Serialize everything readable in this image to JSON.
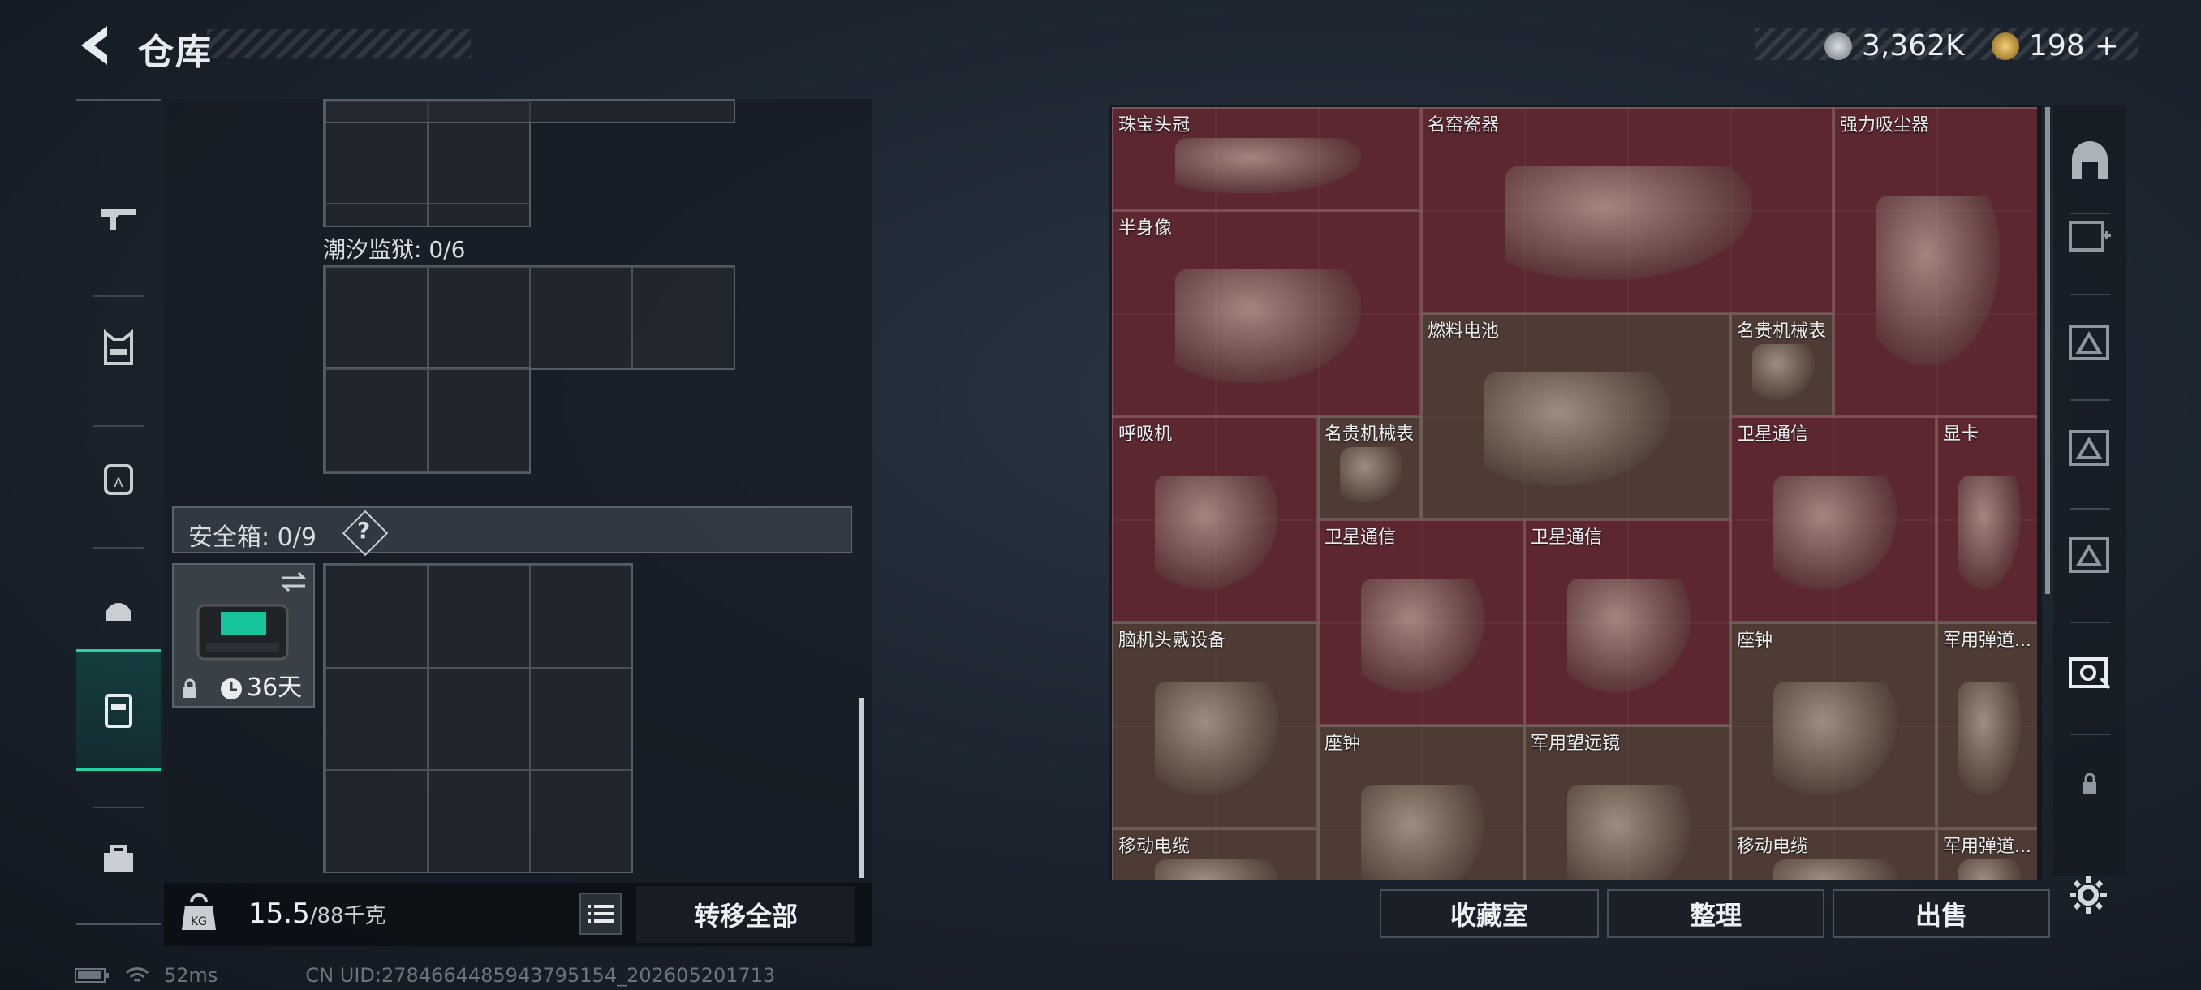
{
  "header": {
    "title": "仓库",
    "back_icon": "back-arrow-icon"
  },
  "currency": [
    {
      "icon": "silver-coin-icon",
      "color": "#a9b2ba",
      "value": "3,362K"
    },
    {
      "icon": "gold-coin-icon",
      "color": "#c9a447",
      "value": "198"
    }
  ],
  "currency_plus": "+",
  "rail": {
    "items": [
      {
        "name": "gun-icon"
      },
      {
        "name": "vest-icon"
      },
      {
        "name": "backpack-icon"
      },
      {
        "name": "helmet-icon"
      },
      {
        "name": "safe-box-icon"
      },
      {
        "name": "toolbox-icon"
      }
    ],
    "active_index": 4
  },
  "left": {
    "tide_prison_label": "潮汐监狱: 0/6",
    "safe_box_label": "安全箱: 0/9",
    "help_label": "?",
    "safe_item": {
      "duration": "36天"
    },
    "weight": {
      "current": "15.5",
      "max": "/88千克"
    },
    "transfer_all": "转移全部"
  },
  "right": {
    "items": [
      {
        "name": "珠宝头冠",
        "col": 0,
        "row": 0,
        "w": 3,
        "h": 1,
        "bg": "maroon"
      },
      {
        "name": "名窑瓷器",
        "col": 3,
        "row": 0,
        "w": 4,
        "h": 2,
        "bg": "maroon"
      },
      {
        "name": "强力吸尘器",
        "col": 7,
        "row": 0,
        "w": 2,
        "h": 3,
        "bg": "maroon"
      },
      {
        "name": "半身像",
        "col": 0,
        "row": 1,
        "w": 3,
        "h": 2,
        "bg": "maroon"
      },
      {
        "name": "燃料电池",
        "col": 3,
        "row": 2,
        "w": 3,
        "h": 2,
        "bg": "brown"
      },
      {
        "name": "名贵机械表",
        "col": 6,
        "row": 2,
        "w": 1,
        "h": 1,
        "bg": "brown"
      },
      {
        "name": "呼吸机",
        "col": 0,
        "row": 3,
        "w": 2,
        "h": 2,
        "bg": "maroon"
      },
      {
        "name": "名贵机械表",
        "col": 2,
        "row": 3,
        "w": 1,
        "h": 1,
        "bg": "brown"
      },
      {
        "name": "卫星通信",
        "col": 6,
        "row": 3,
        "w": 2,
        "h": 2,
        "bg": "maroon"
      },
      {
        "name": "显卡",
        "col": 8,
        "row": 3,
        "w": 1,
        "h": 2,
        "bg": "maroon"
      },
      {
        "name": "卫星通信",
        "col": 2,
        "row": 4,
        "w": 2,
        "h": 2,
        "bg": "maroon"
      },
      {
        "name": "卫星通信",
        "col": 4,
        "row": 4,
        "w": 2,
        "h": 2,
        "bg": "maroon"
      },
      {
        "name": "脑机头戴设备",
        "col": 0,
        "row": 5,
        "w": 2,
        "h": 2,
        "bg": "brown"
      },
      {
        "name": "座钟",
        "col": 6,
        "row": 5,
        "w": 2,
        "h": 2,
        "bg": "brown"
      },
      {
        "name": "军用弹道...",
        "col": 8,
        "row": 5,
        "w": 1,
        "h": 2,
        "bg": "brown"
      },
      {
        "name": "座钟",
        "col": 2,
        "row": 6,
        "w": 2,
        "h": 2,
        "bg": "brown"
      },
      {
        "name": "军用望远镜",
        "col": 4,
        "row": 6,
        "w": 2,
        "h": 2,
        "bg": "brown"
      },
      {
        "name": "移动电缆",
        "col": 0,
        "row": 7,
        "w": 2,
        "h": 1,
        "bg": "brown"
      },
      {
        "name": "移动电缆",
        "col": 6,
        "row": 7,
        "w": 2,
        "h": 1,
        "bg": "brown"
      },
      {
        "name": "军用弹道...",
        "col": 8,
        "row": 7,
        "w": 1,
        "h": 1,
        "bg": "brown"
      }
    ],
    "actions": [
      "收藏室",
      "整理",
      "出售"
    ],
    "side_tabs": [
      "helmet-tab-icon",
      "grade-iv-plus-icon",
      "grade-iv-armor-icon",
      "grade-iv-armor-icon",
      "grade-gt-armor-icon",
      "grade-v-armor-icon",
      "lock-icon",
      "settings-icon"
    ]
  },
  "status": {
    "ping": "52ms",
    "uid": "CN UID:2784664485943795154_202605201713"
  }
}
